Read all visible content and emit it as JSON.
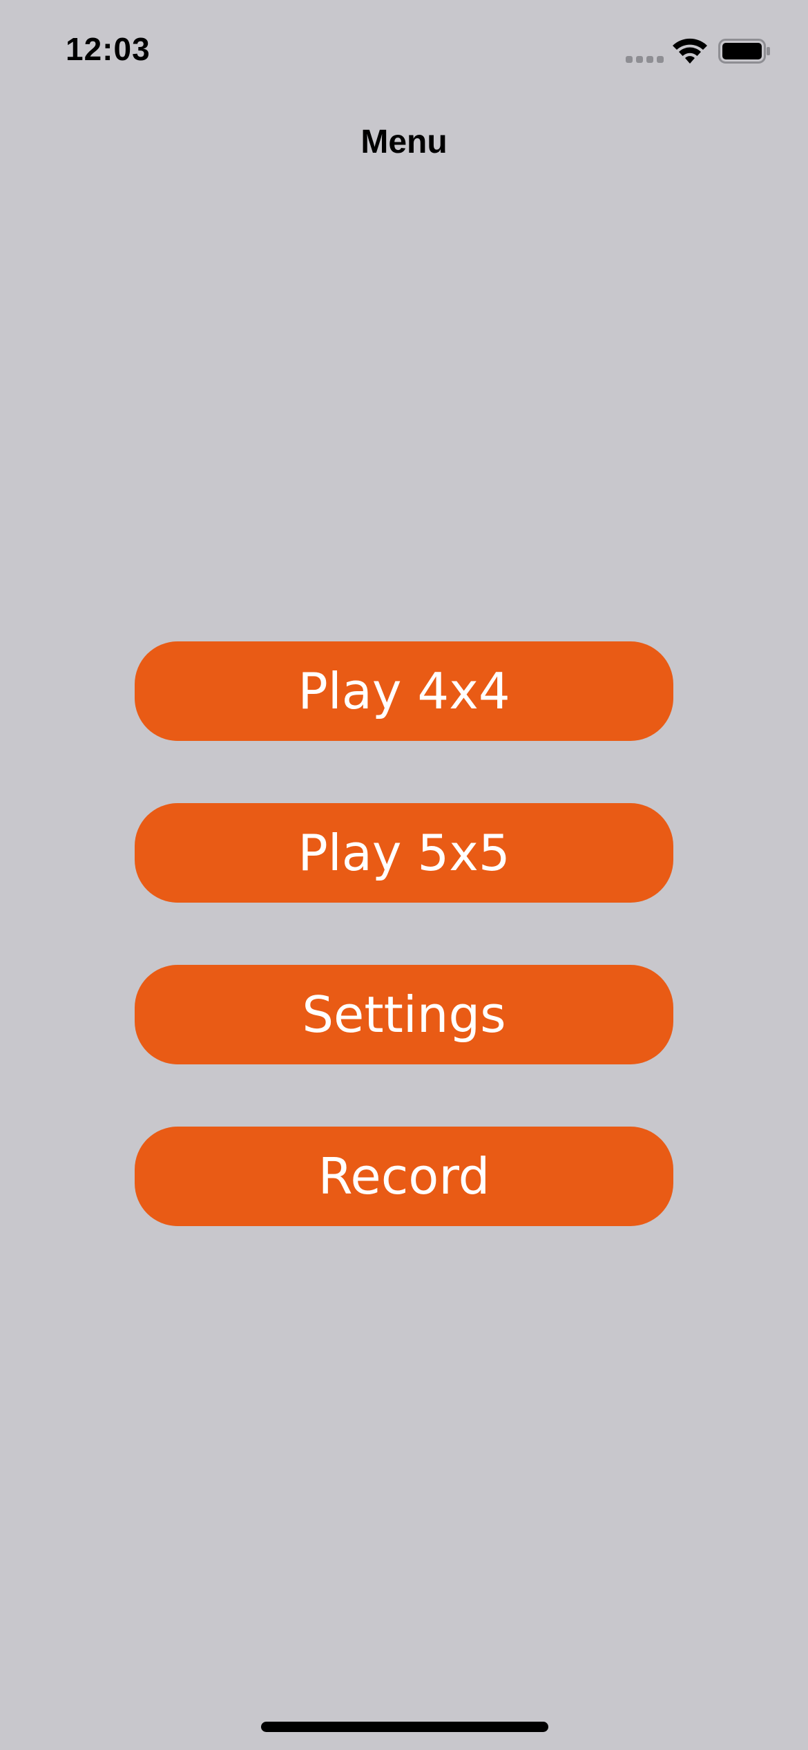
{
  "status_bar": {
    "time": "12:03",
    "signal_icon": "cellular-signal-icon",
    "wifi_icon": "wifi-icon",
    "battery_icon": "battery-icon"
  },
  "nav": {
    "title": "Menu"
  },
  "menu": {
    "buttons": [
      {
        "label": "Play 4x4"
      },
      {
        "label": "Play 5x5"
      },
      {
        "label": "Settings"
      },
      {
        "label": "Record"
      }
    ]
  },
  "colors": {
    "background": "#c8c7cc",
    "button": "#e95b15",
    "button_text": "#ffffff"
  }
}
